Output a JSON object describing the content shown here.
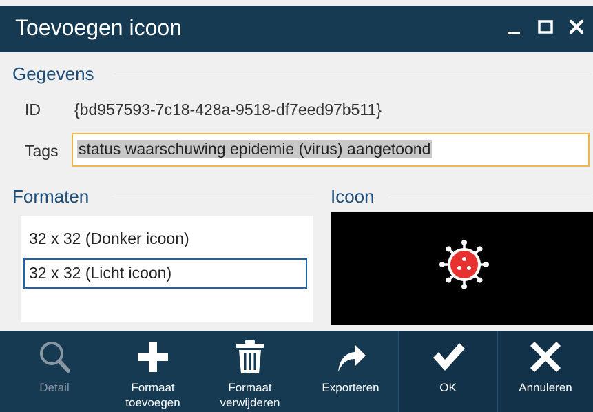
{
  "window": {
    "title": "Toevoegen icoon",
    "controls": [
      "minimize-icon",
      "maximize-icon",
      "close-icon"
    ]
  },
  "gegevens": {
    "heading": "Gegevens",
    "id_label": "ID",
    "id_value": "{bd957593-7c18-428a-9518-df7eed97b511}",
    "tags_label": "Tags",
    "tags_value": "status waarschuwing epidemie (virus) aangetoond"
  },
  "formaten": {
    "heading": "Formaten",
    "items": [
      {
        "label": "32 x 32 (Donker icoon)",
        "selected": false
      },
      {
        "label": "32 x 32 (Licht icoon)",
        "selected": true
      }
    ]
  },
  "icoon": {
    "heading": "Icoon",
    "preview_icon": "virus-icon",
    "preview_color": "#e8322f",
    "preview_background": "#000000"
  },
  "toolbar": {
    "buttons": [
      {
        "id": "detail",
        "label": "Detail",
        "icon": "magnifier-icon",
        "enabled": false
      },
      {
        "id": "add",
        "label": "Formaat\ntoevoegen",
        "icon": "plus-icon",
        "enabled": true
      },
      {
        "id": "remove",
        "label": "Formaat\nverwijderen",
        "icon": "trash-icon",
        "enabled": true
      },
      {
        "id": "export",
        "label": "Exporteren",
        "icon": "share-arrow-icon",
        "enabled": true
      },
      {
        "id": "ok",
        "label": "OK",
        "icon": "checkmark-icon",
        "enabled": true
      },
      {
        "id": "cancel",
        "label": "Annuleren",
        "icon": "x-icon",
        "enabled": true
      }
    ]
  },
  "colors": {
    "titlebar": "#163a52",
    "accent": "#1e4e7a",
    "tags_border": "#f0b84b",
    "selection_border": "#1c64b0"
  }
}
